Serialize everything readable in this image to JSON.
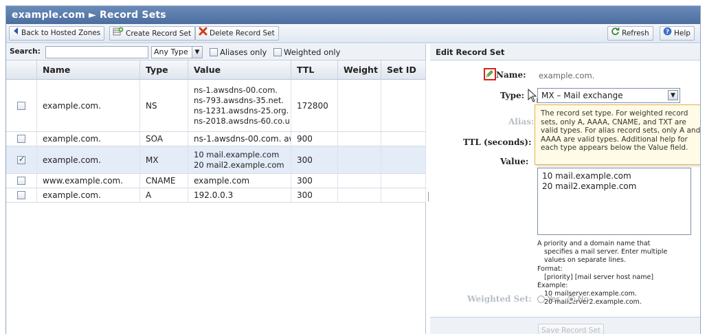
{
  "window": {
    "title": "example.com ► Record Sets"
  },
  "toolbar": {
    "back_label": "Back to Hosted Zones",
    "create_label": "Create Record Set",
    "delete_label": "Delete Record Set",
    "refresh_label": "Refresh",
    "help_label": "Help"
  },
  "search": {
    "label": "Search:",
    "value": "",
    "type_filter": "Any Type",
    "aliases_label": "Aliases only",
    "weighted_label": "Weighted only"
  },
  "grid": {
    "columns": [
      "",
      "Name",
      "Type",
      "Value",
      "TTL",
      "Weight",
      "Set ID"
    ],
    "rows": [
      {
        "checked": false,
        "name": "example.com.",
        "type": "NS",
        "value": [
          "ns-1.awsdns-00.com.",
          "ns-793.awsdns-35.net.",
          "ns-1231.awsdns-25.org.",
          "ns-2018.awsdns-60.co.u"
        ],
        "ttl": "172800",
        "weight": "",
        "set_id": ""
      },
      {
        "checked": false,
        "name": "example.com.",
        "type": "SOA",
        "value": [
          "ns-1.awsdns-00.com. aw"
        ],
        "ttl": "900",
        "weight": "",
        "set_id": ""
      },
      {
        "checked": true,
        "name": "example.com.",
        "type": "MX",
        "value": [
          "10 mail.example.com",
          "20 mail2.example.com"
        ],
        "ttl": "300",
        "weight": "",
        "set_id": ""
      },
      {
        "checked": false,
        "name": "www.example.com.",
        "type": "CNAME",
        "value": [
          "example.com"
        ],
        "ttl": "300",
        "weight": "",
        "set_id": ""
      },
      {
        "checked": false,
        "name": "example.com.",
        "type": "A",
        "value": [
          "192.0.0.3"
        ],
        "ttl": "300",
        "weight": "",
        "set_id": ""
      }
    ]
  },
  "edit": {
    "header": "Edit Record Set",
    "name_label": "Name:",
    "name_value": "example.com.",
    "type_label": "Type:",
    "type_value": "MX – Mail exchange",
    "alias_label": "Alias:",
    "ttl_label": "TTL (seconds):",
    "value_label": "Value:",
    "value_lines": [
      "10 mail.example.com",
      "20 mail2.example.com"
    ],
    "tooltip": "The record set type. For weighted record sets, only A, AAAA, CNAME, and TXT are valid types. For alias record sets, only A and AAAA are valid types. Additional help for each type appears below the Value field.",
    "help_lines": [
      {
        "text": "A priority and a domain name that",
        "indent": false
      },
      {
        "text": "specifies a mail server. Enter multiple",
        "indent": true
      },
      {
        "text": "values on separate lines.",
        "indent": true
      },
      {
        "text": "Format:",
        "indent": false
      },
      {
        "text": "[priority] [mail server host name]",
        "indent": true
      },
      {
        "text": "Example:",
        "indent": false
      },
      {
        "text": "10 mailserver.example.com.",
        "indent": true
      },
      {
        "text": "20 mailserver2.example.com.",
        "indent": true
      }
    ],
    "weighted_label": "Weighted Set:",
    "weighted_yes": "Yes",
    "weighted_no": "No",
    "save_label": "Save Record Set"
  }
}
